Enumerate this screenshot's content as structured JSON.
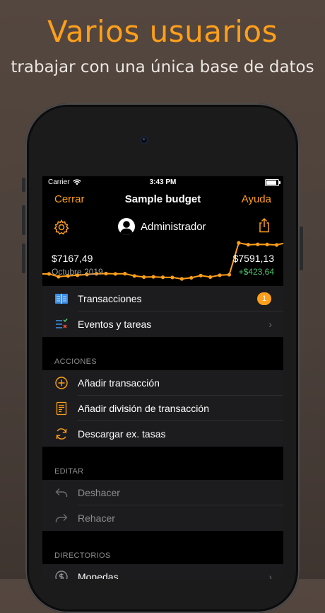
{
  "promo": {
    "headline": "Varios usuarios",
    "subline": "trabajar con una única base de datos"
  },
  "status_bar": {
    "carrier": "Carrier",
    "time": "3:43 PM"
  },
  "nav": {
    "left": "Cerrar",
    "title": "Sample budget",
    "right": "Ayuda"
  },
  "user": {
    "name": "Administrador"
  },
  "chart_data": {
    "type": "line",
    "series": [
      {
        "values": [
          7167.49,
          7168,
          7130,
          7140,
          7150,
          7160,
          7170,
          7172,
          7168,
          7171,
          7140,
          7125,
          7128,
          7122,
          7120,
          7100,
          7115,
          7145,
          7125,
          7150,
          7157,
          7590,
          7565,
          7570,
          7568,
          7562,
          7591.13
        ]
      }
    ],
    "start_value": "$7167,49",
    "start_label": "Octubre 2019",
    "end_value": "$7591,13",
    "change": "+$423,64",
    "line_color": "#ff9f1a"
  },
  "main_list": [
    {
      "icon": "book-icon",
      "label": "Transacciones",
      "badge": "1"
    },
    {
      "icon": "checklist-icon",
      "label": "Eventos y tareas"
    }
  ],
  "acciones": {
    "header": "ACCIONES",
    "items": [
      {
        "icon": "plus-circle-icon",
        "label": "Añadir transacción"
      },
      {
        "icon": "receipt-icon",
        "label": "Añadir división de transacción"
      },
      {
        "icon": "refresh-icon",
        "label": "Descargar ex. tasas"
      }
    ]
  },
  "editar": {
    "header": "EDITAR",
    "items": [
      {
        "icon": "undo-icon",
        "label": "Deshacer"
      },
      {
        "icon": "redo-icon",
        "label": "Rehacer"
      }
    ]
  },
  "directorios": {
    "header": "DIRECTORIOS",
    "items": [
      {
        "icon": "coin-icon",
        "label": "Monedas"
      }
    ]
  },
  "colors": {
    "accent": "#ff9f1a",
    "positive": "#4cc36b",
    "row_bg": "#1c1c1e"
  }
}
